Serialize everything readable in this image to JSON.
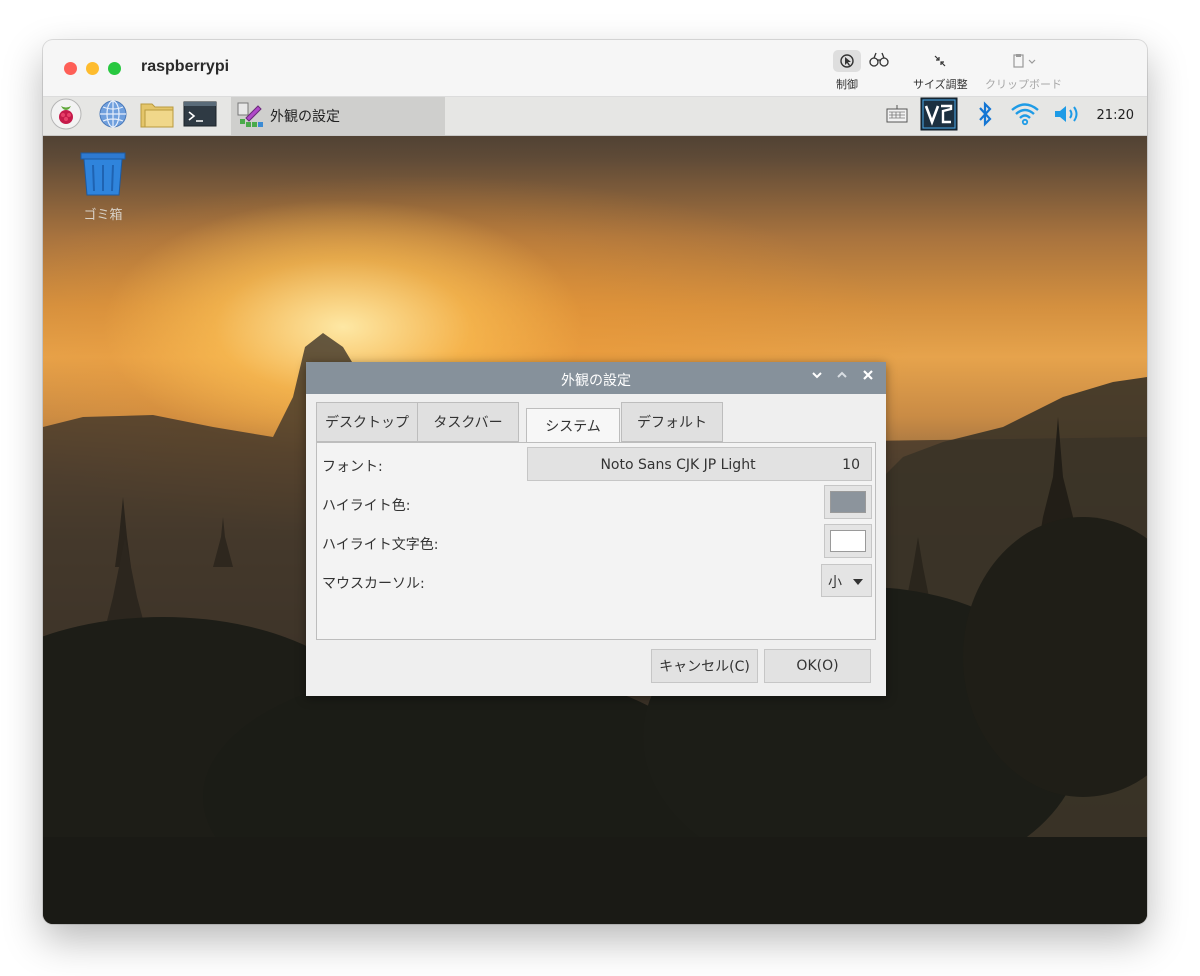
{
  "window": {
    "title": "raspberrypi",
    "toolbar": {
      "control_label": "制御",
      "resize_label": "サイズ調整",
      "clipboard_label": "クリップボード"
    }
  },
  "panel": {
    "icons": [
      "raspberry-menu-icon",
      "web-browser-icon",
      "file-manager-icon",
      "terminal-icon"
    ],
    "task_label": "外観の設定",
    "clock": "21:20"
  },
  "desktop": {
    "trash_label": "ゴミ箱"
  },
  "dialog": {
    "title": "外観の設定",
    "tabs": [
      "デスクトップ",
      "タスクバー",
      "システム",
      "デフォルト"
    ],
    "active_tab": "システム",
    "rows": {
      "font_label": "フォント:",
      "font_name": "Noto Sans CJK JP Light",
      "font_size": "10",
      "highlight_label": "ハイライト色:",
      "highlight_color": "#8c949c",
      "highlight_text_label": "ハイライト文字色:",
      "highlight_text_color": "#ffffff",
      "cursor_label": "マウスカーソル:",
      "cursor_value": "小"
    },
    "cancel_label": "キャンセル(C)",
    "ok_label": "OK(O)"
  },
  "colors": {
    "dialog_titlebar": "#86919b",
    "panel": "#e6e6e4"
  }
}
